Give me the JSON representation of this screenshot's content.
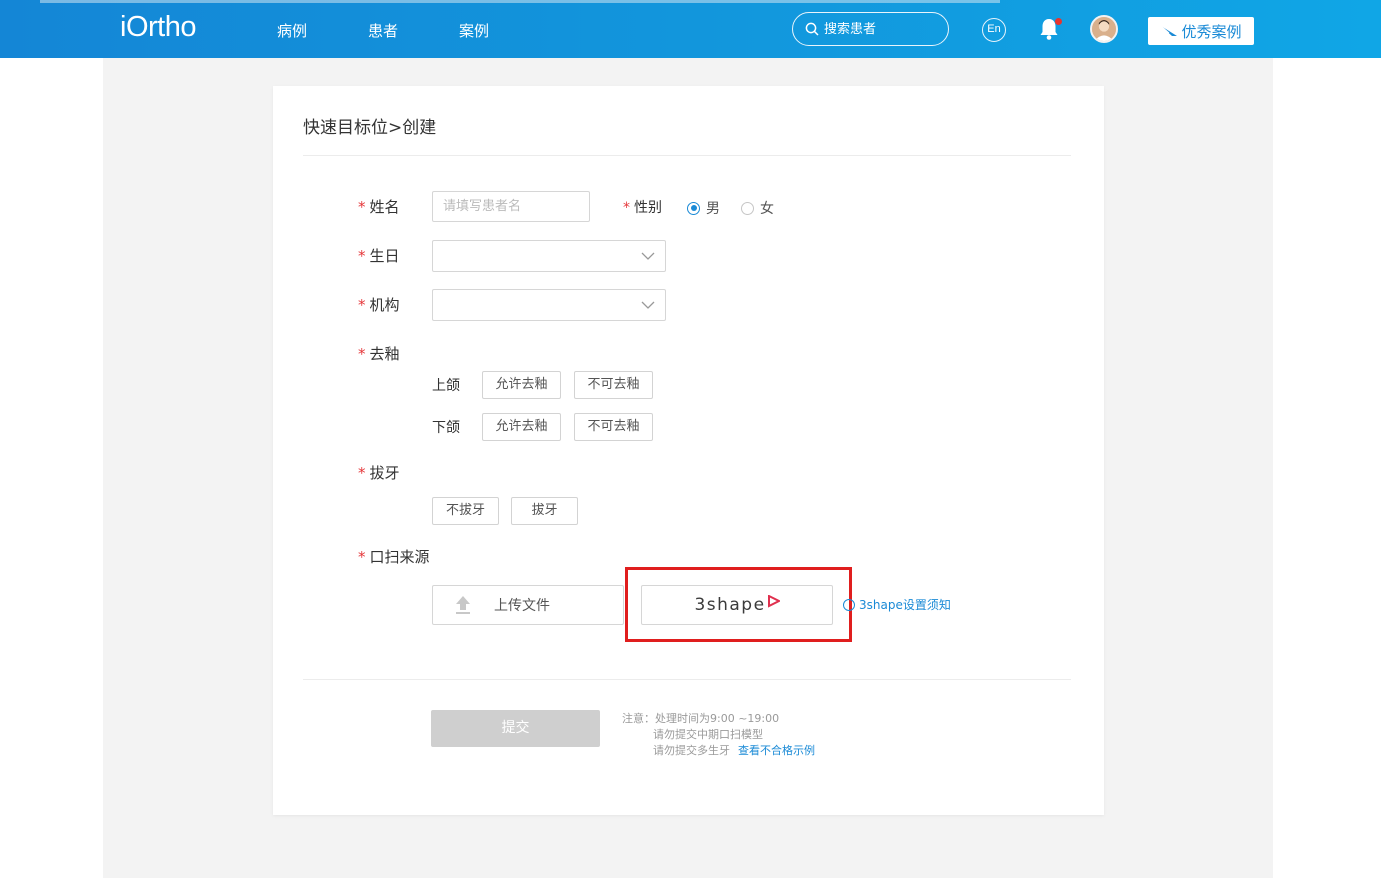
{
  "header": {
    "logo": "iOrtho",
    "nav": [
      "病例",
      "患者",
      "案例"
    ],
    "search_placeholder": "搜索患者",
    "lang": "En",
    "featured_cases_label": "优秀案例"
  },
  "form": {
    "title": "快速目标位>创建",
    "name_label": "姓名",
    "name_placeholder": "请填写患者名",
    "gender_label": "性别",
    "gender_options": [
      "男",
      "女"
    ],
    "gender_selected": "男",
    "birthday_label": "生日",
    "institution_label": "机构",
    "enamel_label": "去釉",
    "upper_jaw_label": "上颌",
    "lower_jaw_label": "下颌",
    "allow_enamel": "允许去釉",
    "disallow_enamel": "不可去釉",
    "extraction_label": "拔牙",
    "no_extraction": "不拔牙",
    "extraction": "拔牙",
    "scan_source_label": "口扫来源",
    "upload_label": "上传文件",
    "shape_label": "3shape",
    "shape_help_link": "3shape设置须知",
    "submit_label": "提交",
    "notes": {
      "line1": "注意：处理时间为9:00 ~19:00",
      "line2": "请勿提交中期口扫模型",
      "line3": "请勿提交多生牙",
      "link": "查看不合格示例"
    }
  },
  "colors": {
    "brand": "#1296dc",
    "required": "#e5383b",
    "link": "#1a8ad6",
    "highlight": "#e01e1e"
  }
}
